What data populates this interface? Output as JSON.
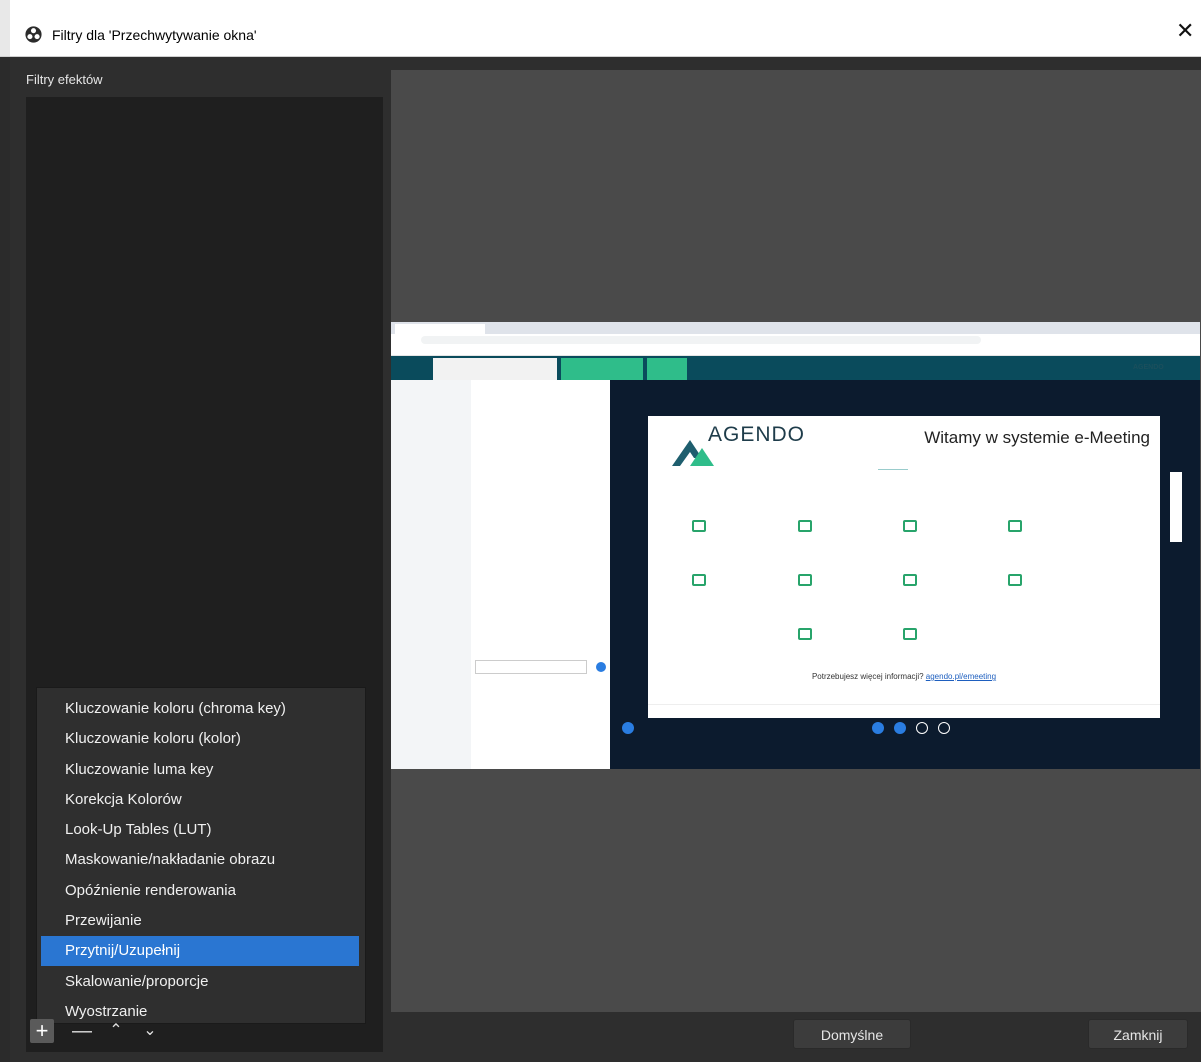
{
  "window": {
    "title": "Filtry dla 'Przechwytywanie okna'"
  },
  "filters": {
    "label": "Filtry efektów"
  },
  "menu": {
    "items": [
      "Kluczowanie koloru (chroma key)",
      "Kluczowanie koloru (kolor)",
      "Kluczowanie luma key",
      "Korekcja Kolorów",
      "Look-Up Tables (LUT)",
      "Maskowanie/nakładanie obrazu",
      "Opóźnienie renderowania",
      "Przewijanie",
      "Przytnij/Uzupełnij",
      "Skalowanie/proporcje",
      "Wyostrzanie"
    ],
    "selected_index": 8
  },
  "preview": {
    "brand": "AGENDO",
    "welcome": "Witamy w systemie e-Meeting",
    "more_prefix": "Potrzebujesz więcej informacji?",
    "more_link": "agendo.pl/emeeting"
  },
  "buttons": {
    "defaults": "Domyślne",
    "close": "Zamknij"
  },
  "icons": {
    "close": "close-icon",
    "app": "obs-icon",
    "add": "plus-icon",
    "remove": "minus-icon",
    "up": "chevron-up-icon",
    "down": "chevron-down-icon"
  },
  "colors": {
    "accent": "#2a76d2",
    "background": "#2e2e2e"
  }
}
